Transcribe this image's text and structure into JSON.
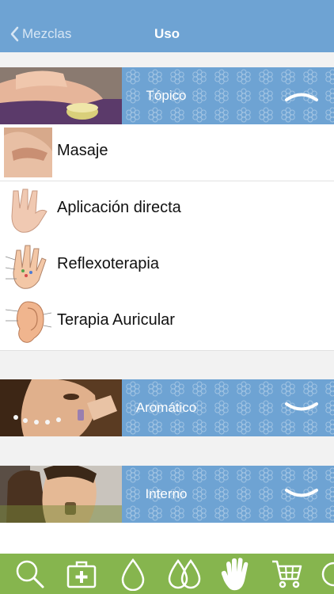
{
  "nav": {
    "back_label": "Mezclas",
    "title": "Uso"
  },
  "sections": [
    {
      "label": "Tópico",
      "expanded": true,
      "items": [
        {
          "label": "Masaje"
        },
        {
          "label": "Aplicación directa"
        },
        {
          "label": "Reflexoterapia"
        },
        {
          "label": "Terapia Auricular"
        }
      ]
    },
    {
      "label": "Aromático",
      "expanded": false,
      "items": []
    },
    {
      "label": "Interno",
      "expanded": false,
      "items": []
    }
  ],
  "tabbar": {
    "tabs": [
      "search-icon",
      "first-aid-icon",
      "drop-icon",
      "drops-icon",
      "hand-icon",
      "cart-icon",
      "more-icon"
    ],
    "active": "hand-icon",
    "colors": {
      "background": "#86b54e",
      "icon": "#ffffff"
    }
  },
  "colors": {
    "navbar": "#6ea3d3",
    "section": "#6ea3d3"
  }
}
